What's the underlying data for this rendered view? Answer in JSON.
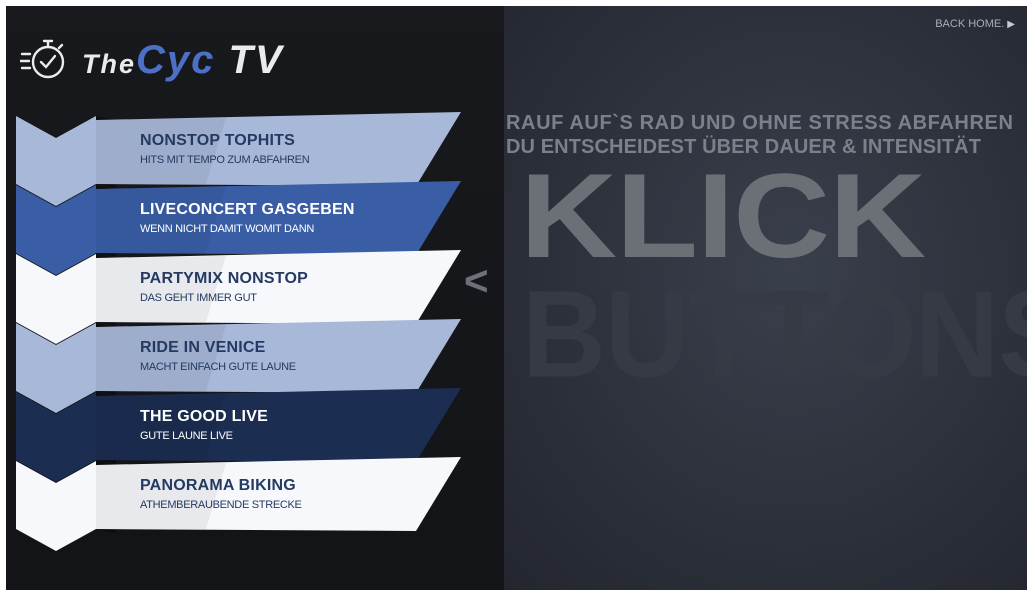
{
  "header": {
    "logo_icon": "stopwatch-check-icon",
    "logo_prefix": "The",
    "logo_accent": "Cyc",
    "logo_suffix": "TV"
  },
  "nav": {
    "back_label": "BACK HOME.",
    "back_icon": "play-arrow-icon"
  },
  "menu": [
    {
      "title": "NONSTOP TOPHITS",
      "subtitle": "HITS MIT TEMPO ZUM ABFAHREN",
      "bg": "#a8b8d8",
      "text": "#243a62"
    },
    {
      "title": "LIVECONCERT GASGEBEN",
      "subtitle": "WENN NICHT DAMIT WOMIT DANN",
      "bg": "#3a5ea6",
      "text": "#ffffff"
    },
    {
      "title": "PARTYMIX NONSTOP",
      "subtitle": "DAS GEHT IMMER GUT",
      "bg": "#f7f8fb",
      "text": "#243a62"
    },
    {
      "title": "RIDE IN VENICE",
      "subtitle": "MACHT EINFACH GUTE LAUNE",
      "bg": "#a8b8d8",
      "text": "#243a62"
    },
    {
      "title": "THE GOOD LIVE",
      "subtitle": "GUTE LAUNE LIVE",
      "bg": "#1c2d52",
      "text": "#ffffff"
    },
    {
      "title": "PANORAMA BIKING",
      "subtitle": "ATHEMBERAUBENDE STRECKE",
      "bg": "#f7f8fb",
      "text": "#243a62"
    }
  ],
  "tagline": {
    "line1": "RAUF AUF`S RAD UND OHNE STRESS ABFAHREN",
    "line2": "DU ENTSCHEIDEST ÜBER DAUER & INTENSITÄT"
  },
  "hint": {
    "arrow": "<",
    "word1": "KLICK",
    "word2": "BUTTONS"
  }
}
